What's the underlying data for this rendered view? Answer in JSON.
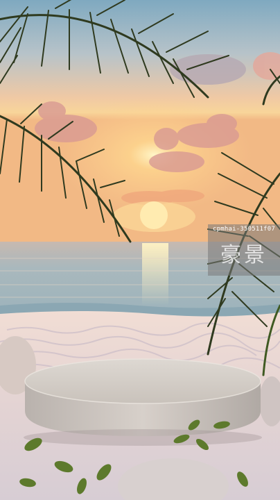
{
  "image": {
    "subject": "tropical beach sunset with round stone podium",
    "colors": {
      "sky_top": "#8fb4c8",
      "sky_mid": "#f2c79a",
      "sun": "#fff1b8",
      "sea": "#a9b9bf",
      "sand": "#ead9d2",
      "podium": "#d9d3cc",
      "palm": "#2f3a1f"
    }
  },
  "watermark": {
    "id_text": "cpmhai-350511f07",
    "mark_text": "豪景"
  }
}
